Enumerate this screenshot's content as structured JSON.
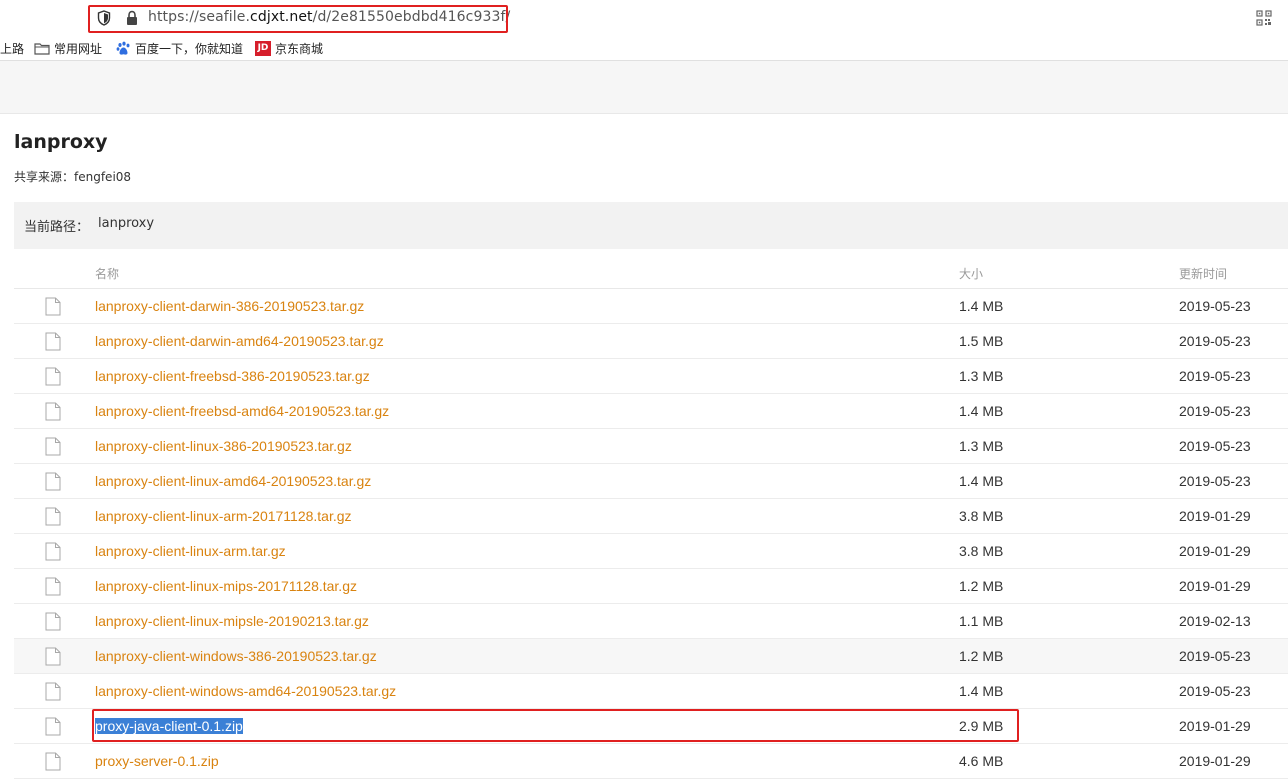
{
  "browser": {
    "url_prefix": "https://seafile.",
    "url_host": "cdjxt.net",
    "url_suffix": "/d/2e81550ebdbd416c933f/",
    "accent_box_color": "#e02020"
  },
  "bookmarks": [
    {
      "label": "上路",
      "icon": ""
    },
    {
      "label": "常用网址",
      "icon": "folder-icon"
    },
    {
      "label": "百度一下，你就知道",
      "icon": "baidu-paw-icon"
    },
    {
      "label": "京东商城",
      "icon": "jd-logo-icon",
      "badge": "JD"
    }
  ],
  "library": {
    "title": "lanproxy",
    "shared_by": "共享来源：fengfei08"
  },
  "path": {
    "label": "当前路径：",
    "value": "lanproxy"
  },
  "table": {
    "headers": {
      "name": "名称",
      "size": "大小",
      "time": "更新时间"
    },
    "rows": [
      {
        "name": "lanproxy-client-darwin-386-20190523.tar.gz",
        "size": "1.4 MB",
        "time": "2019-05-23"
      },
      {
        "name": "lanproxy-client-darwin-amd64-20190523.tar.gz",
        "size": "1.5 MB",
        "time": "2019-05-23"
      },
      {
        "name": "lanproxy-client-freebsd-386-20190523.tar.gz",
        "size": "1.3 MB",
        "time": "2019-05-23"
      },
      {
        "name": "lanproxy-client-freebsd-amd64-20190523.tar.gz",
        "size": "1.4 MB",
        "time": "2019-05-23"
      },
      {
        "name": "lanproxy-client-linux-386-20190523.tar.gz",
        "size": "1.3 MB",
        "time": "2019-05-23"
      },
      {
        "name": "lanproxy-client-linux-amd64-20190523.tar.gz",
        "size": "1.4 MB",
        "time": "2019-05-23"
      },
      {
        "name": "lanproxy-client-linux-arm-20171128.tar.gz",
        "size": "3.8 MB",
        "time": "2019-01-29"
      },
      {
        "name": "lanproxy-client-linux-arm.tar.gz",
        "size": "3.8 MB",
        "time": "2019-01-29"
      },
      {
        "name": "lanproxy-client-linux-mips-20171128.tar.gz",
        "size": "1.2 MB",
        "time": "2019-01-29"
      },
      {
        "name": "lanproxy-client-linux-mipsle-20190213.tar.gz",
        "size": "1.1 MB",
        "time": "2019-02-13"
      },
      {
        "name": "lanproxy-client-windows-386-20190523.tar.gz",
        "size": "1.2 MB",
        "time": "2019-05-23"
      },
      {
        "name": "lanproxy-client-windows-amd64-20190523.tar.gz",
        "size": "1.4 MB",
        "time": "2019-05-23"
      },
      {
        "name": "proxy-java-client-0.1.zip",
        "size": "2.9 MB",
        "time": "2019-01-29"
      },
      {
        "name": "proxy-server-0.1.zip",
        "size": "4.6 MB",
        "time": "2019-01-29"
      }
    ]
  },
  "colors": {
    "link": "#d98310",
    "selection": "#3b80d6"
  }
}
